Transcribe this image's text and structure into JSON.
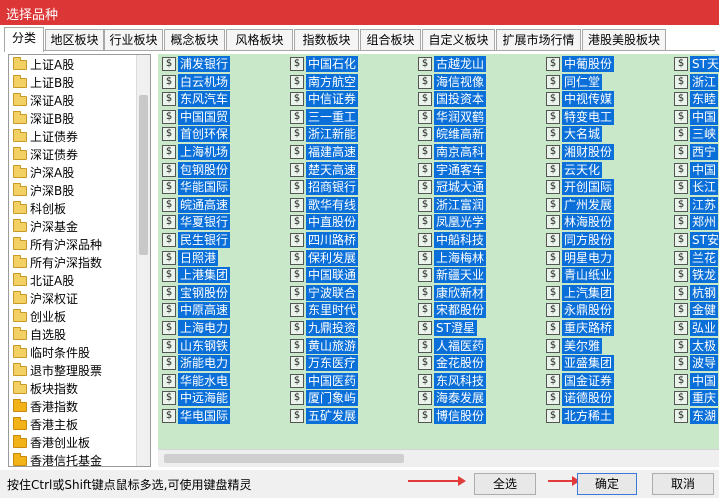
{
  "window": {
    "title": "选择品种"
  },
  "tabs": [
    {
      "label": "分类",
      "active": true
    },
    {
      "label": "地区板块"
    },
    {
      "label": "行业板块"
    },
    {
      "label": "概念板块"
    },
    {
      "label": "风格板块"
    },
    {
      "label": "指数板块"
    },
    {
      "label": "组合板块"
    },
    {
      "label": "自定义板块"
    },
    {
      "label": "扩展市场行情"
    },
    {
      "label": "港股美股板块"
    }
  ],
  "categories": [
    {
      "label": "上证A股",
      "selected": true
    },
    {
      "label": "上证B股"
    },
    {
      "label": "深证A股"
    },
    {
      "label": "深证B股"
    },
    {
      "label": "上证债券"
    },
    {
      "label": "深证债券"
    },
    {
      "label": "沪深A股"
    },
    {
      "label": "沪深B股"
    },
    {
      "label": "科创板"
    },
    {
      "label": "沪深基金"
    },
    {
      "label": "所有沪深品种"
    },
    {
      "label": "所有沪深指数"
    },
    {
      "label": "北证A股"
    },
    {
      "label": "沪深权证"
    },
    {
      "label": "创业板"
    },
    {
      "label": "自选股"
    },
    {
      "label": "临时条件股"
    },
    {
      "label": "退市整理股票"
    },
    {
      "label": "板块指数"
    },
    {
      "label": "香港指数"
    },
    {
      "label": "香港主板"
    },
    {
      "label": "香港创业板"
    },
    {
      "label": "香港信托基金"
    }
  ],
  "stocks": {
    "icon": "$",
    "columns": [
      [
        "浦发银行",
        "白云机场",
        "东风汽车",
        "中国国贸",
        "首创环保",
        "上海机场",
        "包钢股份",
        "华能国际",
        "皖通高速",
        "华夏银行",
        "民生银行",
        "日照港",
        "上港集团",
        "宝钢股份",
        "中原高速",
        "上海电力",
        "山东钢铁",
        "浙能电力",
        "华能水电",
        "中远海能",
        "华电国际"
      ],
      [
        "中国石化",
        "南方航空",
        "中信证券",
        "三一重工",
        "浙江新能",
        "福建高速",
        "楚天高速",
        "招商银行",
        "歌华有线",
        "中直股份",
        "四川路桥",
        "保利发展",
        "中国联通",
        "宁波联合",
        "东里时代",
        "九鼎投资",
        "黄山旅游",
        "万东医疗",
        "中国医药",
        "厦门象屿",
        "五矿发展"
      ],
      [
        "古越龙山",
        "海信视像",
        "国投资本",
        "华润双鹤",
        "皖维高新",
        "南京高科",
        "宇通客车",
        "冠城大通",
        "浙江富润",
        "凤凰光学",
        "中船科技",
        "上海梅林",
        "新疆天业",
        "康欣新材",
        "宋都股份",
        "ST澄星",
        "人福医药",
        "金花股份",
        "东风科技",
        "海泰发展",
        "博信股份"
      ],
      [
        "中葡股份",
        "同仁堂",
        "中视传媒",
        "特变电工",
        "大名城",
        "湘财股份",
        "云天化",
        "开创国际",
        "广州发展",
        "林海股份",
        "同方股份",
        "明星电力",
        "青山纸业",
        "上汽集团",
        "永鼎股份",
        "重庆路桥",
        "美尔雅",
        "亚盛集团",
        "国金证券",
        "诺德股份",
        "北方稀土"
      ],
      [
        "ST天",
        "浙江",
        "东睦",
        "中国",
        "三峡",
        "西宁",
        "中国",
        "长江",
        "江苏",
        "郑州",
        "ST安",
        "兰花",
        "铁龙",
        "杭钢",
        "金健",
        "弘业",
        "太极",
        "波导",
        "中国",
        "重庆",
        "东湖"
      ]
    ]
  },
  "footer": {
    "hint": "按住Ctrl或Shift键点鼠标多选,可使用键盘精灵",
    "select_all": "全选",
    "ok": "确定",
    "cancel": "取消",
    "annotation_color": "#e23b3b"
  }
}
